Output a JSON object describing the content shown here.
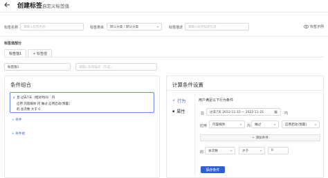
{
  "header": {
    "back_icon": "arrow-left-icon",
    "title": "创建标签",
    "subtitle": "自定义标签值"
  },
  "form": {
    "tag_name_label": "标签名称",
    "tag_name_placeholder": "请输入标签名称",
    "tag_category_label": "标签类目",
    "tag_category_value": "默认分类 / 默认分类",
    "tag_desc_label": "标签描述",
    "tag_desc_placeholder": "请输入标签描述信息",
    "example_label": "标签示例"
  },
  "values_section": {
    "title": "标签值部分",
    "tabs": [
      "标签值1",
      "+ 标签值"
    ],
    "value_input": "标签值1",
    "value_desc_placeholder": "请输入标签描述（可选）"
  },
  "left_panel": {
    "title": "条件组合",
    "conditions": [
      "且  过去7天（相对时间）  内",
      "应用    内容媒体    内   做过   应用启动(预置)",
      "的   总次数   大于   0"
    ],
    "add_condition": "+ 条件",
    "add_group": "+ 条件组"
  },
  "right_panel": {
    "title": "计算条件设置",
    "side_items": [
      {
        "icon": "action-icon",
        "label": "行为"
      },
      {
        "icon": "attribute-icon",
        "label": "属性"
      }
    ],
    "intro_text": "用户满足以下行为条件",
    "time_prefix": "在",
    "time_range_type": "过去7天",
    "time_range": "2022-11-15 ~ 2022-11-21",
    "time_suffix": "内",
    "app_prefix": "应用",
    "app_value": "内容媒体",
    "app_in": "内",
    "did_value": "做过",
    "event_value": "应用启动(预置)",
    "filter_button": "+ 添加条件",
    "metric_prefix": "的",
    "metric_value": "总次数",
    "operator_value": "大于",
    "threshold_value": "0",
    "save_button": "保存条件"
  },
  "colors": {
    "accent": "#2f5fd0",
    "border": "#d9d9d9"
  }
}
